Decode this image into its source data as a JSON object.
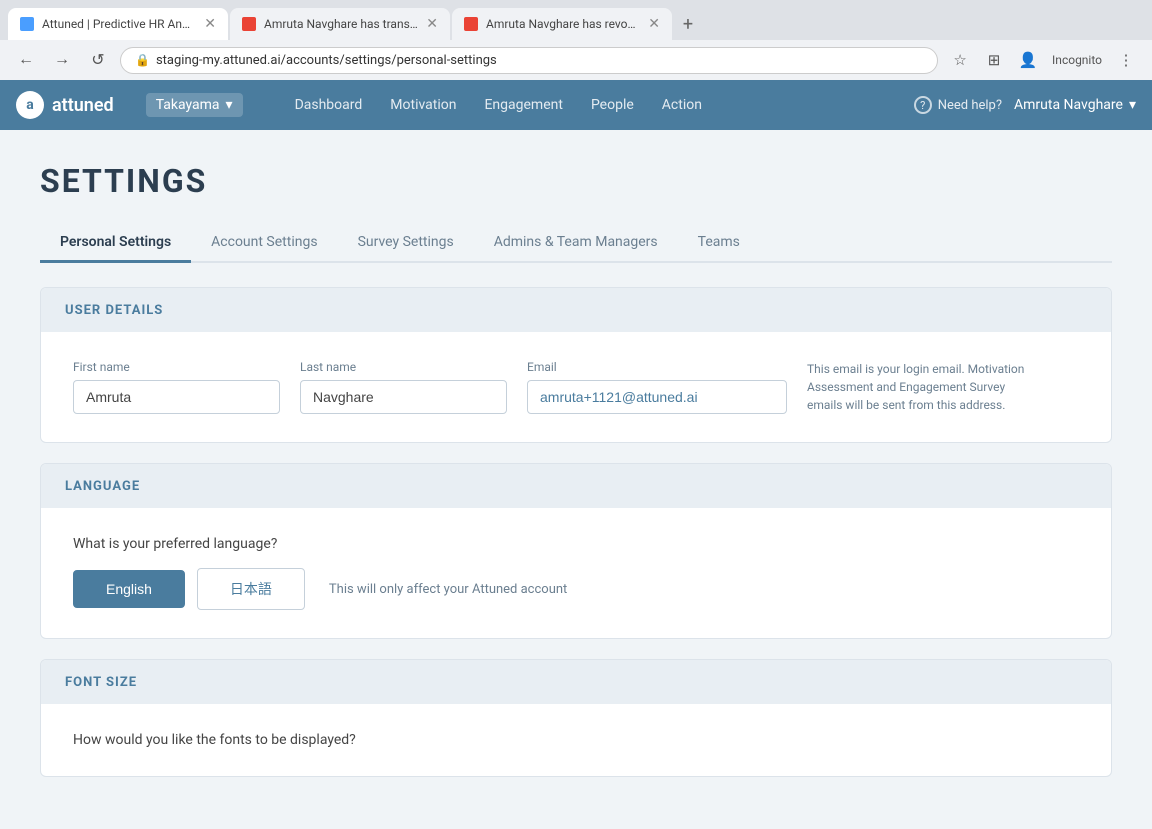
{
  "browser": {
    "tabs": [
      {
        "id": "tab1",
        "favicon_type": "attuned",
        "title": "Attuned | Predictive HR Analy…",
        "active": true
      },
      {
        "id": "tab2",
        "favicon_type": "gmail",
        "title": "Amruta Navghare has transfer…",
        "active": false
      },
      {
        "id": "tab3",
        "favicon_type": "gmail",
        "title": "Amruta Navghare has revoked…",
        "active": false
      }
    ],
    "new_tab_label": "+",
    "address": "staging-my.attuned.ai/accounts/settings/personal-settings",
    "back_icon": "←",
    "forward_icon": "→",
    "reload_icon": "↺",
    "mode_label": "Incognito"
  },
  "app_nav": {
    "logo_text": "attuned",
    "logo_initial": "a",
    "org_selector": {
      "label": "Takayama",
      "chevron": "▾"
    },
    "nav_links": [
      {
        "id": "dashboard",
        "label": "Dashboard"
      },
      {
        "id": "motivation",
        "label": "Motivation"
      },
      {
        "id": "engagement",
        "label": "Engagement"
      },
      {
        "id": "people",
        "label": "People"
      },
      {
        "id": "action",
        "label": "Action"
      }
    ],
    "need_help": {
      "icon": "?",
      "label": "Need help?"
    },
    "user": {
      "name": "Amruta Navghare",
      "chevron": "▾"
    }
  },
  "page": {
    "title": "SETTINGS",
    "tabs": [
      {
        "id": "personal-settings",
        "label": "Personal Settings",
        "active": true
      },
      {
        "id": "account-settings",
        "label": "Account Settings",
        "active": false
      },
      {
        "id": "survey-settings",
        "label": "Survey Settings",
        "active": false
      },
      {
        "id": "admins-team-managers",
        "label": "Admins & Team Managers",
        "active": false
      },
      {
        "id": "teams",
        "label": "Teams",
        "active": false
      }
    ],
    "sections": {
      "user_details": {
        "header": "USER DETAILS",
        "first_name": {
          "label": "First name",
          "value": "Amruta",
          "placeholder": "First name"
        },
        "last_name": {
          "label": "Last name",
          "value": "Navghare",
          "placeholder": "Last name"
        },
        "email": {
          "label": "Email",
          "value": "amruta+1121@attuned.ai",
          "placeholder": "Email",
          "hint": "This email is your login email. Motivation Assessment and Engagement Survey emails will be sent from this address."
        }
      },
      "language": {
        "header": "LANGUAGE",
        "question": "What is your preferred language?",
        "options": [
          {
            "id": "english",
            "label": "English",
            "active": true
          },
          {
            "id": "japanese",
            "label": "日本語",
            "active": false
          }
        ],
        "hint": "This will only affect your Attuned account"
      },
      "font_size": {
        "header": "FONT SIZE",
        "question": "How would you like the fonts to be displayed?"
      }
    }
  }
}
